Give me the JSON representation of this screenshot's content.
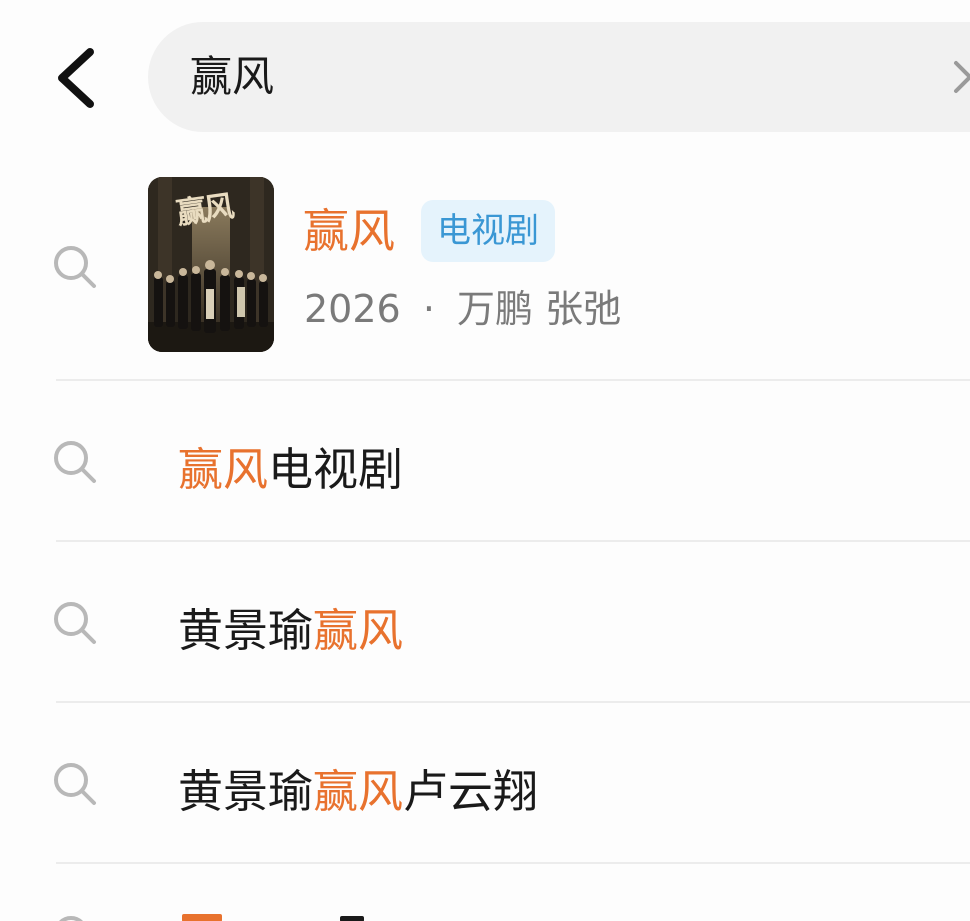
{
  "search": {
    "query": "赢风"
  },
  "icons": {
    "back": "chevron-left-icon",
    "clear": "close-icon",
    "suggestion": "search-icon"
  },
  "colors": {
    "highlight": "#e8722e",
    "tag_text": "#3a97d4",
    "tag_bg": "#e5f3fc",
    "search_bg": "#f1f1f1"
  },
  "card": {
    "title": "赢风",
    "tag": "电视剧",
    "year": "2026",
    "separator": "·",
    "cast": "万鹏 张弛",
    "poster_title": "赢风"
  },
  "suggestions": [
    {
      "prefix": "",
      "highlight": "赢风",
      "suffix": "电视剧"
    },
    {
      "prefix": "黄景瑜",
      "highlight": "赢风",
      "suffix": ""
    },
    {
      "prefix": "黄景瑜",
      "highlight": "赢风",
      "suffix": "卢云翔"
    }
  ]
}
